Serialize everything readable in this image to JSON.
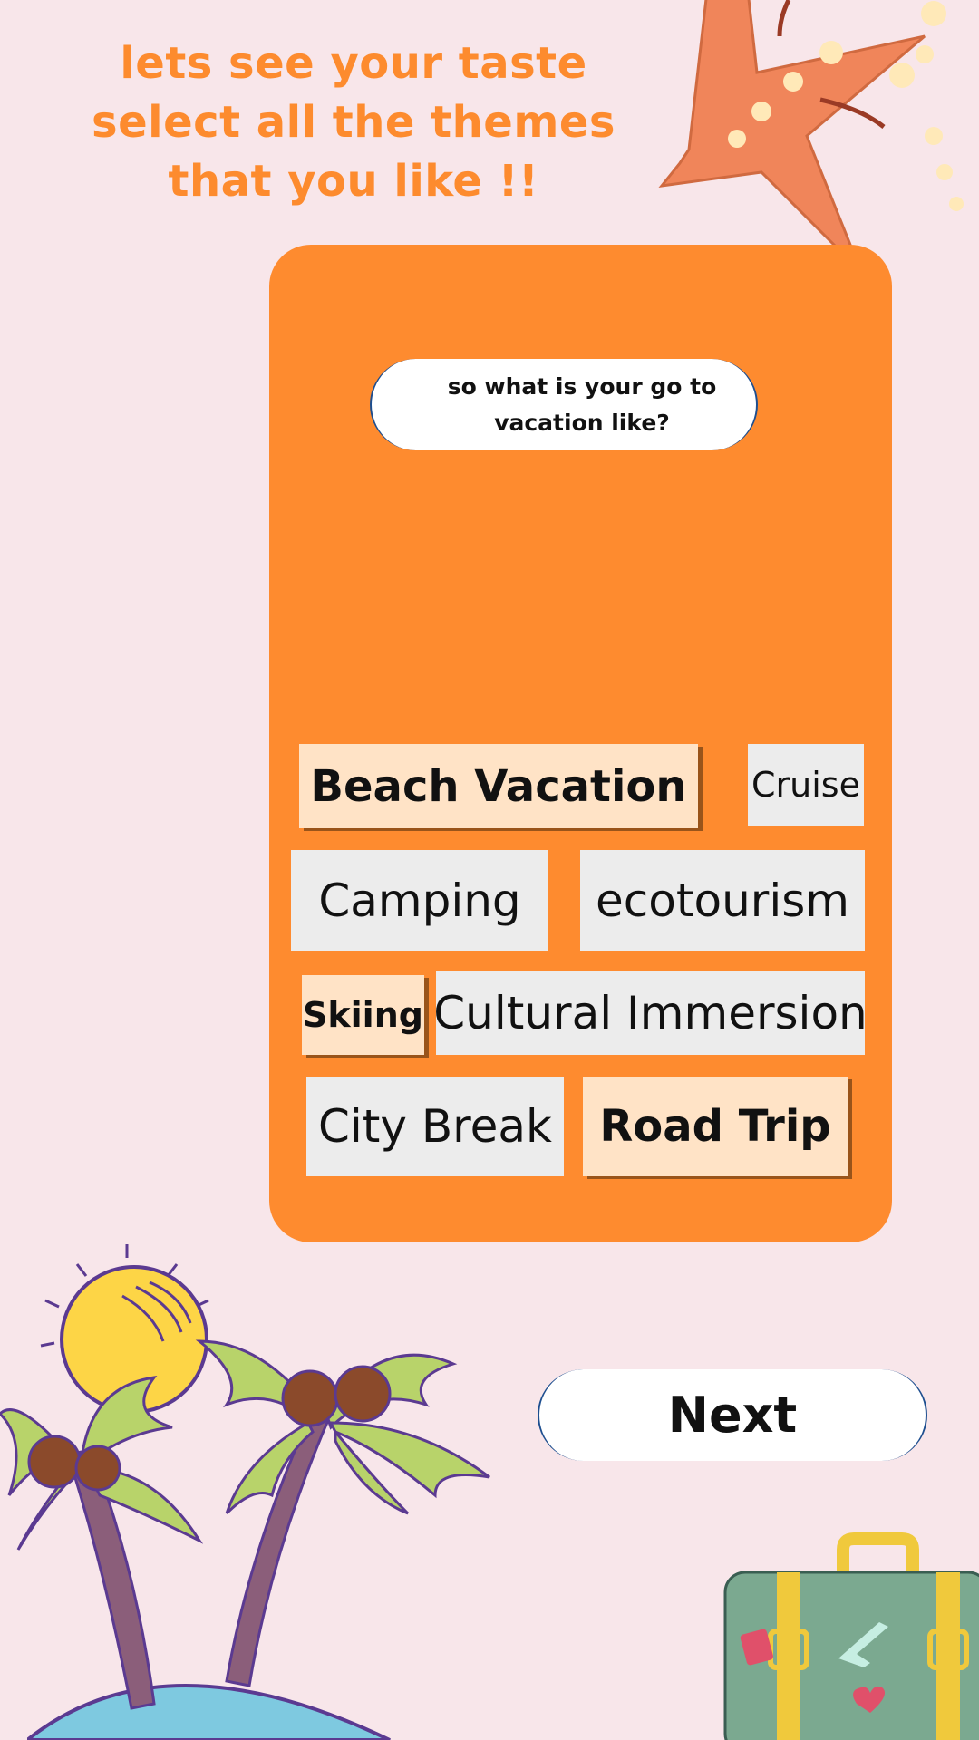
{
  "prompt": {
    "heading": "lets see your taste select all the themes that you like !!"
  },
  "question": "so what is your go to vacation like?",
  "themes": [
    {
      "label": "Beach Vacation",
      "selected": true
    },
    {
      "label": "Cruise",
      "selected": false
    },
    {
      "label": "Camping",
      "selected": false
    },
    {
      "label": "ecotourism",
      "selected": false
    },
    {
      "label": "Skiing",
      "selected": true
    },
    {
      "label": "Cultural Immersion",
      "selected": false
    },
    {
      "label": "City Break",
      "selected": false
    },
    {
      "label": "Road Trip",
      "selected": true
    }
  ],
  "next_label": "Next",
  "colors": {
    "background": "#f8e6ea",
    "accent": "#fd8b2e",
    "card": "#fe8b2f",
    "chip_selected": "#ffe3c6",
    "chip_unselected": "#ececec"
  },
  "decorations": [
    "starfish-icon",
    "sun-icon",
    "palm-trees-icon",
    "island-icon",
    "suitcase-icon"
  ]
}
